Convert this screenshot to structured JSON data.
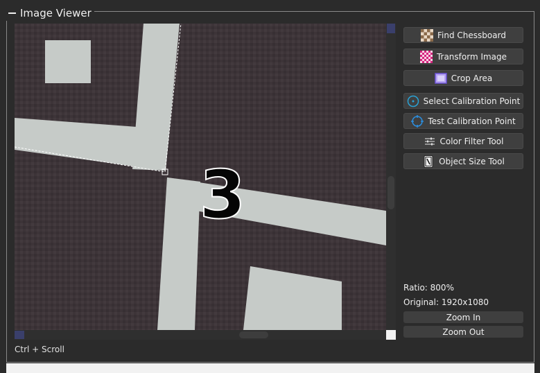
{
  "panel": {
    "title": "Image Viewer"
  },
  "viewer": {
    "overlay_number": "3",
    "hint": "Ctrl + Scroll"
  },
  "tools": [
    {
      "label": "Find Chessboard",
      "icon": "chessboard-icon"
    },
    {
      "label": "Transform Image",
      "icon": "transform-grid-icon"
    },
    {
      "label": "Crop Area",
      "icon": "crop-area-icon"
    },
    {
      "label": "Select Calibration Point",
      "icon": "target-circle-icon"
    },
    {
      "label": "Test Calibration Point",
      "icon": "crosshair-circle-icon"
    },
    {
      "label": "Color Filter Tool",
      "icon": "filter-sliders-icon"
    },
    {
      "label": "Object Size Tool",
      "icon": "measure-object-icon"
    }
  ],
  "info": {
    "ratio": "Ratio: 800%",
    "original": "Original: 1920x1080"
  },
  "zoom": {
    "in_label": "Zoom In",
    "out_label": "Zoom Out"
  },
  "colors": {
    "background": "#2b2b2b",
    "button": "#3f3f3f",
    "tape": "#c6cbc8",
    "floor": "#3d3438"
  }
}
